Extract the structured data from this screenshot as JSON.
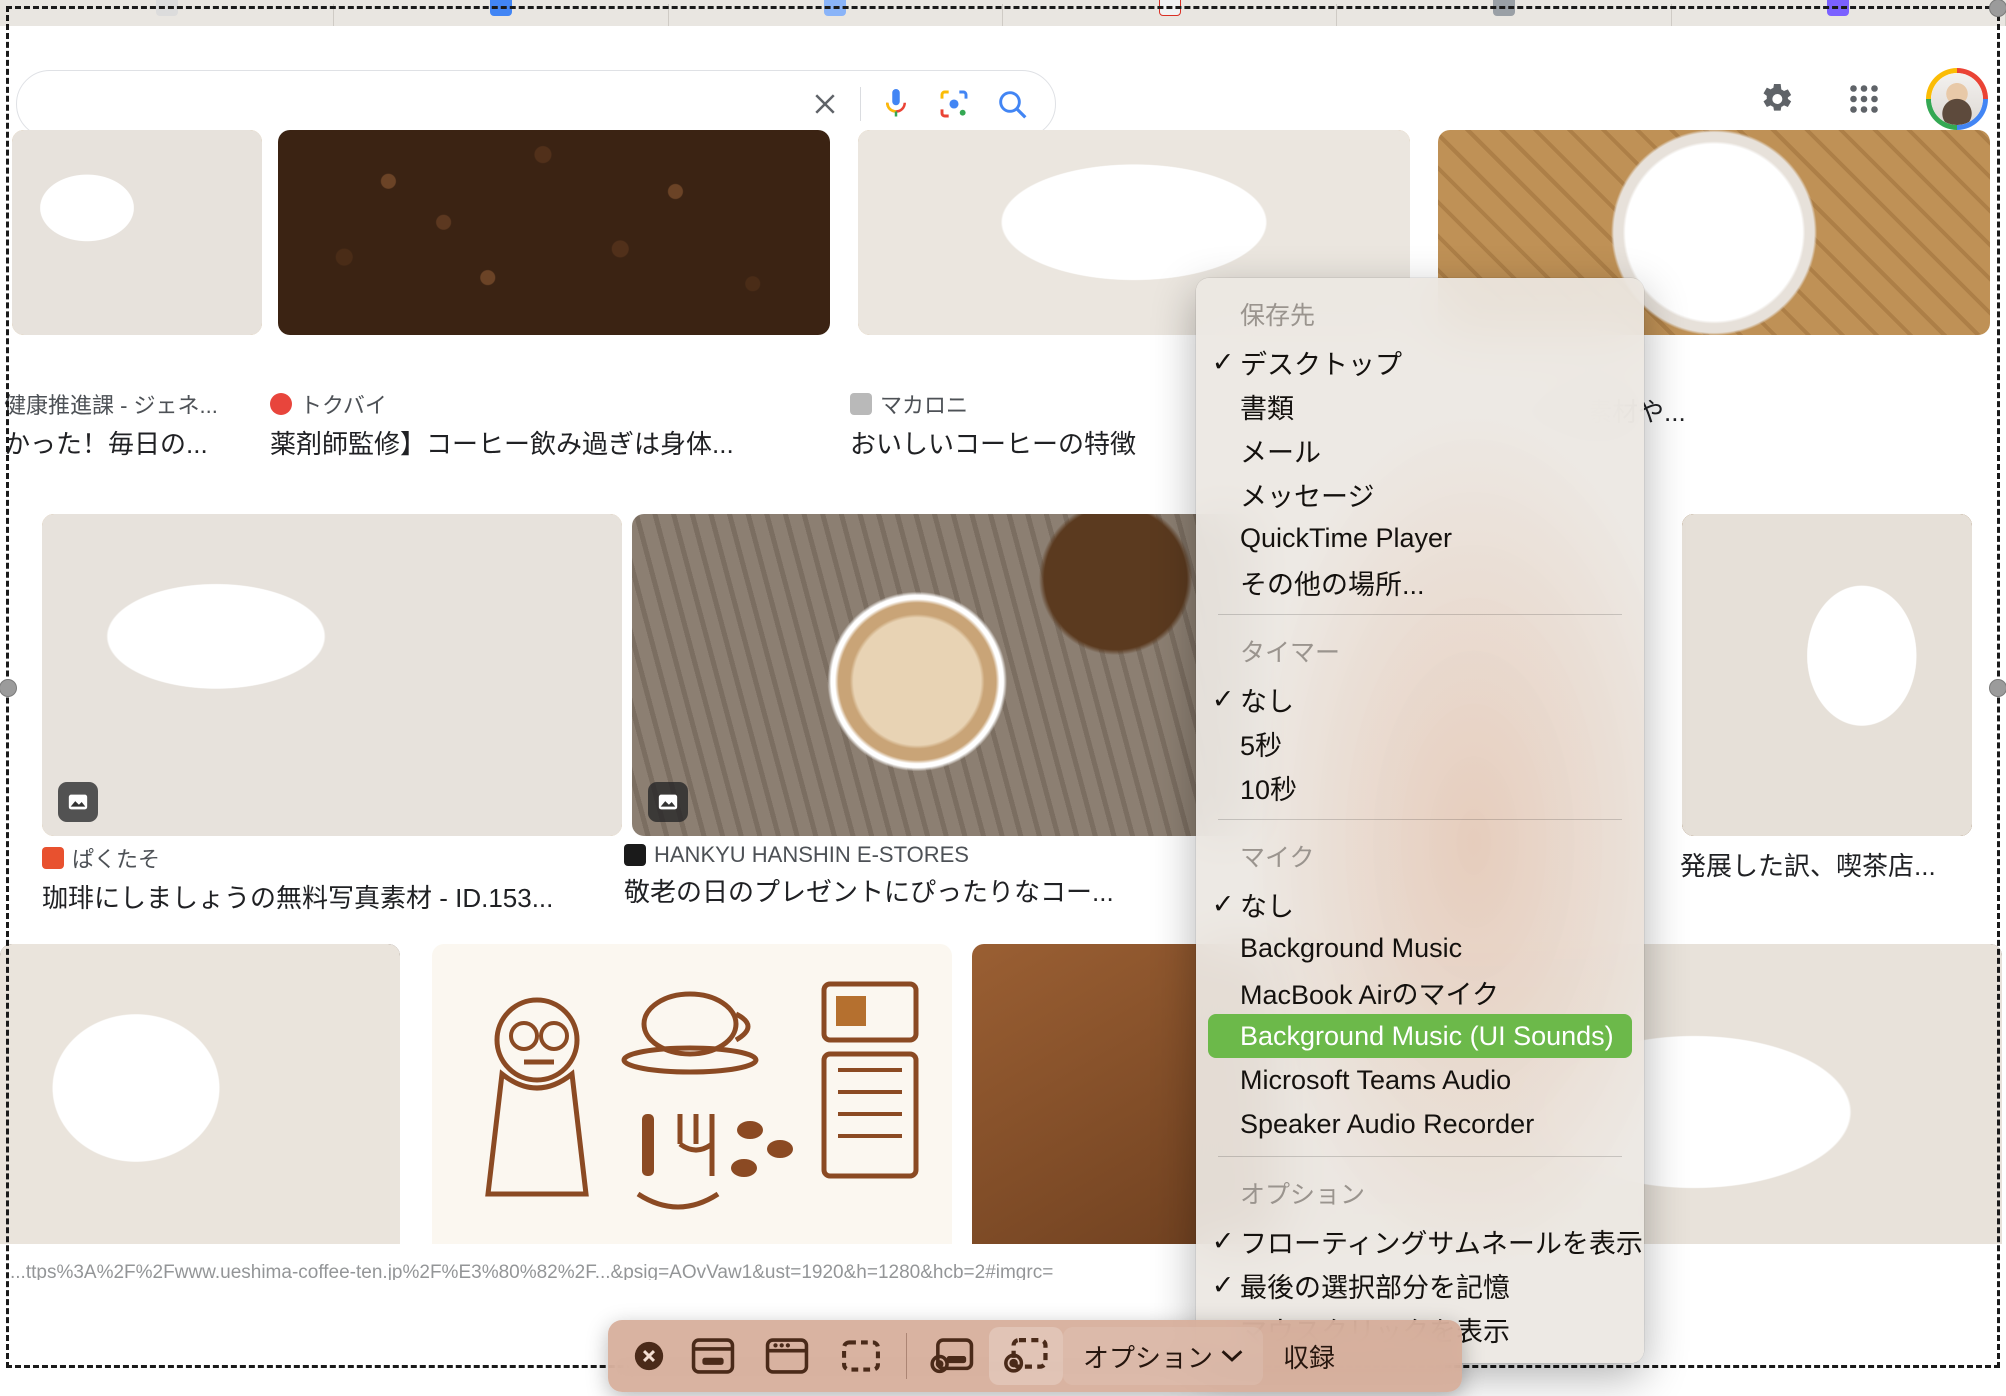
{
  "browser": {
    "tabs": [
      {
        "favicon_color": "#4285f4"
      },
      {
        "favicon_color": "#1a73e8"
      },
      {
        "favicon_color": "#e8eaed"
      },
      {
        "favicon_color": "#d93025"
      },
      {
        "favicon_color": "#8ab4f8"
      },
      {
        "favicon_color": "#9aa0a6"
      }
    ],
    "search": {
      "value": "",
      "placeholder": "",
      "clear_icon": "close-x-icon",
      "mic_icon": "microphone-icon",
      "lens_icon": "google-lens-icon",
      "search_icon": "magnifier-icon"
    },
    "right_cluster": {
      "settings_icon": "gear-icon",
      "apps_icon": "apps-grid-icon",
      "avatar_label": "account-avatar"
    },
    "status_url": "...ttps%3A%2F%2Fwww.ueshima-coffee-ten.jp%2F%E3%80%82%2F...&psig=AOvVaw1&ust=1920&h=1280&hcb=2#imgrc="
  },
  "results": {
    "row1": [
      {
        "source": "健康推進課 - ジェネ...",
        "title": "かった！毎日の...",
        "fav": "#9aa0a6",
        "photo": "p-cupwood"
      },
      {
        "source": "トクバイ",
        "title": "薬剤師監修】コーヒー飲み過ぎは身体...",
        "fav": "#e8453c",
        "photo": "p-beans"
      },
      {
        "source": "マカロニ",
        "title": "おいしいコーヒーの特徴",
        "fav": "#9aa0a6",
        "photo": "p-blackcup"
      },
      {
        "source": "",
        "title": "は、カップの素材や...",
        "fav": "#9aa0a6",
        "photo": "p-topcup"
      }
    ],
    "row2": [
      {
        "source": "ぱくたそ",
        "title": "珈琲にしましょうの無料写真素材 - ID.153...",
        "fav": "#e8512f",
        "photo": "p-cupwood",
        "badge": "image-badge-icon"
      },
      {
        "source": "HANKYU HANSHIN E-STORES",
        "title": "敬老の日のプレゼントにぴったりなコー...",
        "fav": "#1a1a1a",
        "photo": "p-latte",
        "badge": "image-badge-icon"
      },
      {
        "source": "",
        "title": "発展した訳、喫茶店...",
        "fav": "#9aa0a6",
        "photo": "p-pour"
      }
    ],
    "row3": [
      {
        "photo": "p-beancup"
      },
      {
        "photo": "p-illu"
      },
      {
        "photo": "p-brown"
      },
      {
        "photo": "p-steam"
      }
    ]
  },
  "screenshot_toolbar": {
    "close_icon": "close-circle-icon",
    "tools": [
      {
        "name": "capture-entire-screen",
        "icon": "screen-capture-icon",
        "active": false
      },
      {
        "name": "capture-window",
        "icon": "window-capture-icon",
        "active": false
      },
      {
        "name": "capture-selected-portion",
        "icon": "selection-capture-icon",
        "active": false
      },
      {
        "name": "record-entire-screen",
        "icon": "screen-record-icon",
        "active": false
      },
      {
        "name": "record-selected-portion",
        "icon": "selection-record-icon",
        "active": true
      }
    ],
    "options_label": "オプション",
    "options_chevron": "chevron-down-icon",
    "record_label": "収録"
  },
  "options_menu": {
    "sections": [
      {
        "header": "保存先",
        "items": [
          {
            "label": "デスクトップ",
            "checked": true
          },
          {
            "label": "書類",
            "checked": false
          },
          {
            "label": "メール",
            "checked": false
          },
          {
            "label": "メッセージ",
            "checked": false
          },
          {
            "label": "QuickTime Player",
            "checked": false
          },
          {
            "label": "その他の場所...",
            "checked": false
          }
        ]
      },
      {
        "header": "タイマー",
        "items": [
          {
            "label": "なし",
            "checked": true
          },
          {
            "label": "5秒",
            "checked": false
          },
          {
            "label": "10秒",
            "checked": false
          }
        ]
      },
      {
        "header": "マイク",
        "items": [
          {
            "label": "なし",
            "checked": true
          },
          {
            "label": "Background Music",
            "checked": false
          },
          {
            "label": "MacBook Airのマイク",
            "checked": false
          },
          {
            "label": "Background Music (UI Sounds)",
            "checked": false,
            "highlighted": true
          },
          {
            "label": "Microsoft Teams Audio",
            "checked": false
          },
          {
            "label": "Speaker Audio Recorder",
            "checked": false
          }
        ]
      },
      {
        "header": "オプション",
        "items": [
          {
            "label": "フローティングサムネールを表示",
            "checked": true
          },
          {
            "label": "最後の選択部分を記憶",
            "checked": true
          },
          {
            "label": "マウスクリックを表示",
            "checked": false
          }
        ]
      }
    ],
    "highlight_color": "#6cb94a",
    "checkmark": "✓"
  }
}
